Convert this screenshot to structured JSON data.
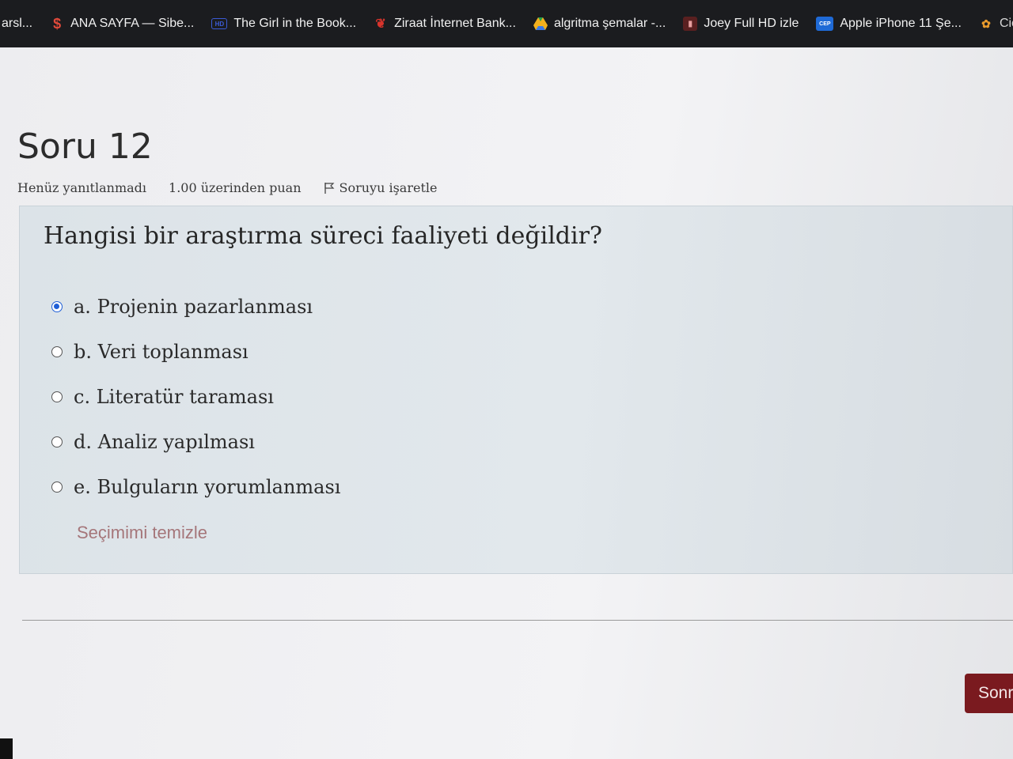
{
  "bookmarks": [
    {
      "label": "arsl...",
      "icon": "none",
      "color": "#1b1c1f"
    },
    {
      "label": "ANA SAYFA — Sibe...",
      "icon": "s-logo-icon",
      "color": "#e24a3b"
    },
    {
      "label": "The Girl in the Book...",
      "icon": "hd-icon",
      "color": "#3b5bd6"
    },
    {
      "label": "Ziraat İnternet Bank...",
      "icon": "wheat-icon",
      "color": "#d8342c"
    },
    {
      "label": "algritma şemalar -...",
      "icon": "google-drive-icon",
      "color": "#f2b01e"
    },
    {
      "label": "Joey Full HD izle",
      "icon": "film-icon",
      "color": "#c0392b"
    },
    {
      "label": "Apple iPhone 11 Şe...",
      "icon": "cep-icon",
      "color": "#1f6ad6"
    },
    {
      "label": "Cicek Si",
      "icon": "flower-icon",
      "color": "#e89a2c"
    }
  ],
  "question": {
    "title": "Soru 12",
    "status": "Henüz yanıtlanmadı",
    "points": "1.00 üzerinden puan",
    "flag_label": "Soruyu işaretle",
    "text": "Hangisi bir araştırma süreci faaliyeti değildir?",
    "options": [
      {
        "label": "a. Projenin pazarlanması",
        "selected": true
      },
      {
        "label": "b. Veri toplanması",
        "selected": false
      },
      {
        "label": "c. Literatür taraması",
        "selected": false
      },
      {
        "label": "d. Analiz yapılması",
        "selected": false
      },
      {
        "label": "e. Bulguların yorumlanması",
        "selected": false
      }
    ],
    "clear_choice": "Seçimimi temizle"
  },
  "navigation": {
    "next_label": "Sonr"
  },
  "colors": {
    "accent": "#7a1a1f",
    "radio_selected": "#1f5fd6",
    "link": "#a5767a"
  }
}
